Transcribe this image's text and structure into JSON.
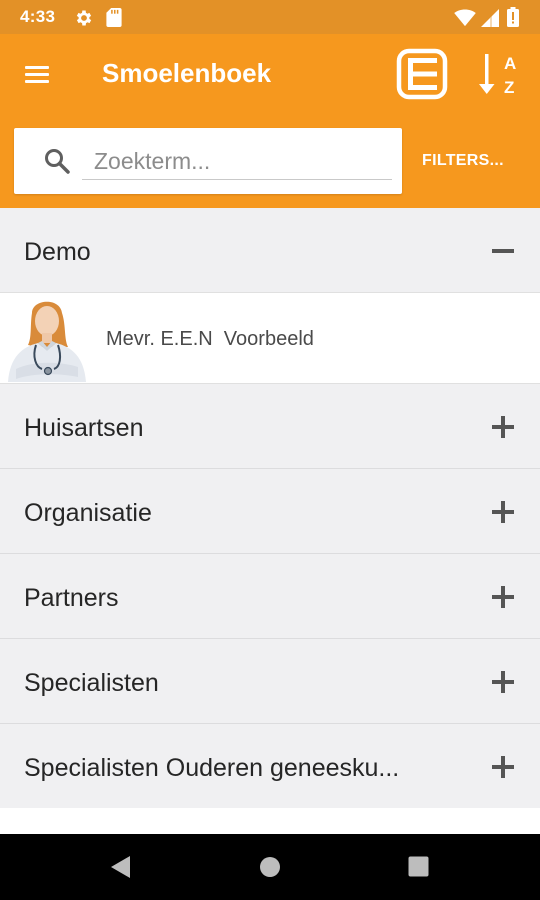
{
  "status_bar": {
    "time": "4:33",
    "icons": [
      "gear-icon",
      "sd-card-icon",
      "wifi-icon",
      "signal-icon",
      "battery-icon"
    ]
  },
  "app_bar": {
    "title": "Smoelenboek",
    "icons": [
      "menu-icon",
      "list-view-icon",
      "sort-az-icon"
    ],
    "sort_letters": [
      "A",
      "Z"
    ]
  },
  "search": {
    "placeholder": "Zoekterm...",
    "value": "",
    "filters_label": "FILTERS..."
  },
  "groups": [
    {
      "label": "Demo",
      "expanded": true,
      "members": [
        {
          "name": "Mevr. E.E.N  Voorbeeld"
        }
      ]
    },
    {
      "label": "Huisartsen",
      "expanded": false
    },
    {
      "label": "Organisatie",
      "expanded": false
    },
    {
      "label": "Partners",
      "expanded": false
    },
    {
      "label": "Specialisten",
      "expanded": false
    },
    {
      "label": "Specialisten Ouderen geneesku...",
      "expanded": false
    }
  ],
  "colors": {
    "status_bar": "#e39127",
    "app_bar": "#f6981e",
    "list_background": "#f0f0f2",
    "text": "#262626"
  },
  "nav_bar": {
    "icons": [
      "back-icon",
      "home-icon",
      "recents-icon"
    ]
  }
}
